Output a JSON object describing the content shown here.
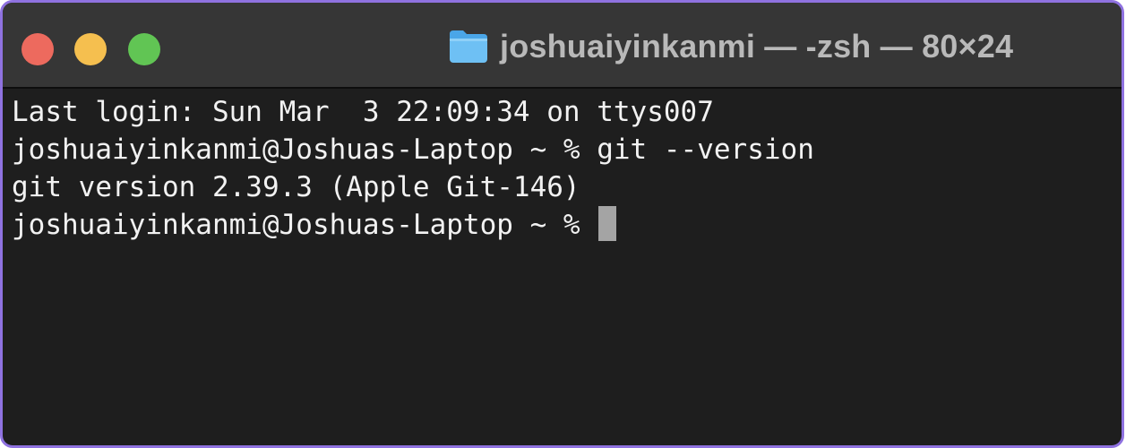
{
  "window": {
    "title": "joshuaiyinkanmi — -zsh — 80×24",
    "title_icon": "folder-icon",
    "colors": {
      "border": "#8f72e0",
      "titlebar": "#363636",
      "terminal_bg": "#1e1e1e",
      "text": "#f2f2f2",
      "close": "#ed6a5e",
      "minimize": "#f5bf4f",
      "zoom": "#61c554",
      "cursor": "#a4a4a4"
    }
  },
  "terminal": {
    "lines": [
      "Last login: Sun Mar  3 22:09:34 on ttys007",
      "joshuaiyinkanmi@Joshuas-Laptop ~ % git --version",
      "git version 2.39.3 (Apple Git-146)"
    ],
    "prompt": "joshuaiyinkanmi@Joshuas-Laptop ~ % "
  }
}
